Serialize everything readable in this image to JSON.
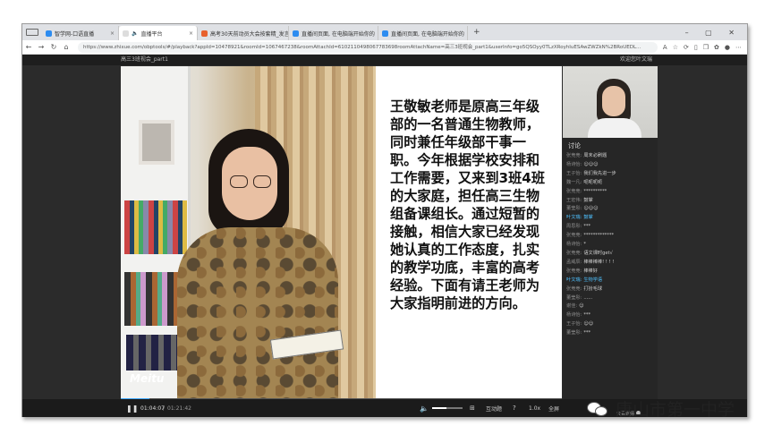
{
  "browser": {
    "tabs": [
      {
        "label": "智学网-口语直播",
        "color": "#2d8cf0",
        "active": false
      },
      {
        "label": "直播平台",
        "color": "#333333",
        "active": true
      },
      {
        "label": "高考30天前动员大会按套精_发言",
        "color": "#e8602c",
        "active": false
      },
      {
        "label": "直播间页面, 在电脑端开始你的",
        "color": "#2d8cf0",
        "active": false
      },
      {
        "label": "直播间页面, 在电脑端开始你的",
        "color": "#2d8cf0",
        "active": false
      }
    ],
    "new_tab": "+",
    "url": "https://www.zhixue.com/obptools/#/playback?appId=10478921&roomId=1067467238&roomAttachId=6102110498067783698roomAttachName=高三3班视会_part1&userInfo=go5QSOyy0TLzXRoyhIuESAwZWZkN%2BRoUEDL..."
  },
  "player": {
    "title": "高三3班视会_part1",
    "welcome": "欢迎您叶文瑞",
    "progress": 0.064,
    "time_current": "01:04:07",
    "time_total": "01:21:42",
    "interact_label": "互动题",
    "speed": "1.0x",
    "fullscreen": "全屏"
  },
  "video": {
    "watermark": "Meitu",
    "slide_text": "王敬敏老师是原高三年级部的一名普通生物教师，同时兼任年级部干事一职。今年根据学校安排和工作需要，又来到3班4班的大家庭，担任高三生物组备课组长。通过短暂的接触，相信大家已经发现她认真的工作态度，扎实的教学功底，丰富的高考经验。下面有请王老师为大家指明前进的方向。"
  },
  "discussion": {
    "title": "讨论",
    "messages": [
      {
        "user": "张竞竞:",
        "text": "周末必刷题",
        "hl": false
      },
      {
        "user": "杨诗怡:",
        "text": "😊😊😊",
        "hl": false
      },
      {
        "user": "王子怡:",
        "text": "我们我先进一步",
        "hl": false
      },
      {
        "user": "魏一凡:",
        "text": "呃呃呃呃",
        "hl": false
      },
      {
        "user": "张竞竞:",
        "text": "**********",
        "hl": false
      },
      {
        "user": "王宏伟:",
        "text": "鼓掌",
        "hl": false
      },
      {
        "user": "董莹彤:",
        "text": "😊😊😊",
        "hl": false
      },
      {
        "user": "叶文瑞:",
        "text": "鼓掌",
        "hl": true
      },
      {
        "user": "周思彤:",
        "text": "***",
        "hl": false
      },
      {
        "user": "张竞竞:",
        "text": "*************",
        "hl": false
      },
      {
        "user": "杨诗怡:",
        "text": "*",
        "hl": false
      },
      {
        "user": "张竞竞:",
        "text": "语文课时get√",
        "hl": false
      },
      {
        "user": "孟威辰:",
        "text": "棒棒棒棒! ! ! !",
        "hl": false
      },
      {
        "user": "张竞竞:",
        "text": "棒棒好",
        "hl": false
      },
      {
        "user": "叶文瑞:",
        "text": "生物学语",
        "hl": true
      },
      {
        "user": "张竞竞:",
        "text": "打扮毛球",
        "hl": false
      },
      {
        "user": "董莹彤:",
        "text": "......",
        "hl": false
      },
      {
        "user": "谢佳:",
        "text": "😊",
        "hl": false
      },
      {
        "user": "杨诗怡:",
        "text": "***",
        "hl": false
      },
      {
        "user": "王子怡:",
        "text": "😊😊",
        "hl": false
      },
      {
        "user": "董莹彤:",
        "text": "***",
        "hl": false
      }
    ],
    "only_teacher": "只看老师"
  },
  "watermark": {
    "text": "唐山市第一中学"
  }
}
